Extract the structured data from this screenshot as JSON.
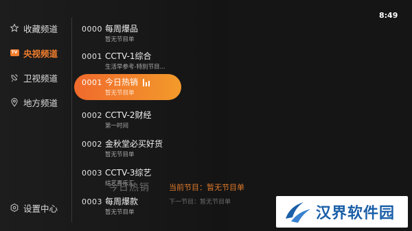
{
  "clock": "8:49",
  "sidebar": {
    "items": [
      {
        "label": "收藏频道",
        "icon": "star-icon"
      },
      {
        "label": "央视频道",
        "icon": "tv-icon",
        "badge": "TV"
      },
      {
        "label": "卫视频道",
        "icon": "satellite-icon"
      },
      {
        "label": "地方频道",
        "icon": "location-pin-icon"
      },
      {
        "label": "设置中心",
        "icon": "settings-icon"
      }
    ],
    "active_index": 1
  },
  "channels": [
    {
      "number": "0000",
      "name": "每周爆品",
      "program": "暂无节目单"
    },
    {
      "number": "0001",
      "name": "CCTV-1综合",
      "program": "生活早参考-特别节目..."
    },
    {
      "number": "0001",
      "name": "今日热销",
      "program": "暂无节目单"
    },
    {
      "number": "0002",
      "name": "CCTV-2财经",
      "program": "第一时间"
    },
    {
      "number": "0002",
      "name": "金秋堂必买好货",
      "program": "暂无节目单"
    },
    {
      "number": "0003",
      "name": "CCTV-3综艺",
      "program": "综艺喜乐汇"
    },
    {
      "number": "0003",
      "name": "每周爆款",
      "program": "暂无节目单"
    }
  ],
  "active_channel_index": 2,
  "info": {
    "channel_title": "今日热销",
    "current_program": "当前节目：暂无节目单",
    "next_program": "下一节目：暂无节目单"
  },
  "watermark": {
    "text": "汉界软件园"
  },
  "colors": {
    "accent": "#f07d2d",
    "accent_gradient_end": "#f39a2b",
    "background": "#151515",
    "watermark_blue": "#1a5fa8"
  }
}
